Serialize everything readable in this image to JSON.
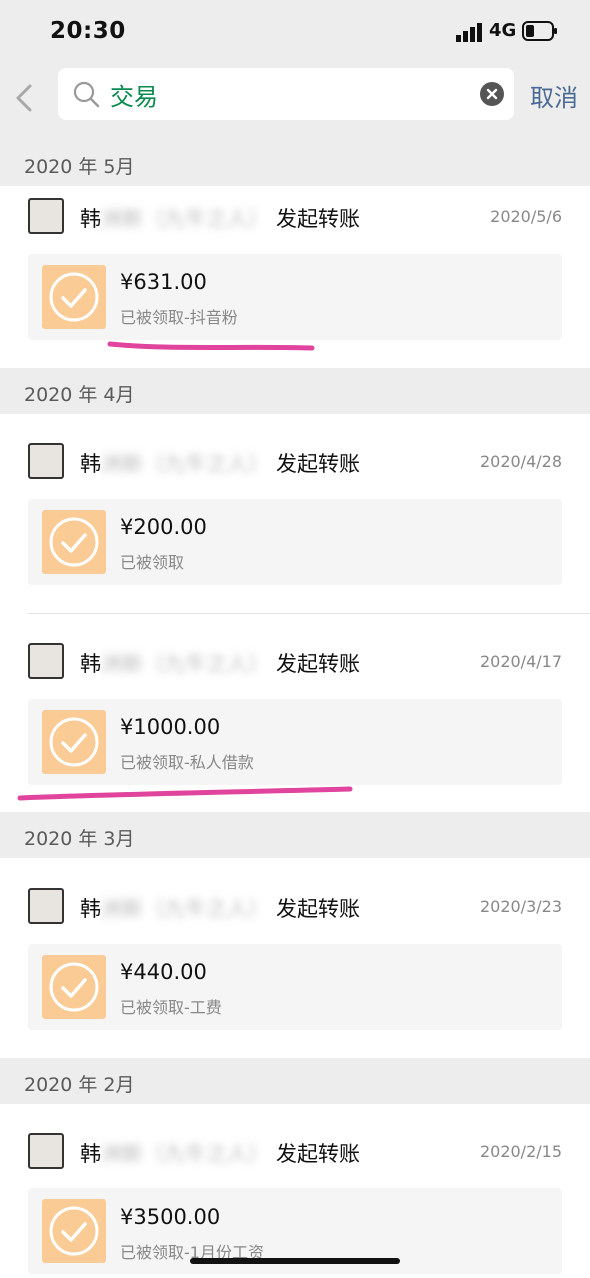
{
  "status_bar": {
    "time": "20:30",
    "network": "4G"
  },
  "search": {
    "query": "交易",
    "cancel_label": "取消"
  },
  "sections": [
    {
      "label": "2020 年 5月"
    },
    {
      "label": "2020 年 4月"
    },
    {
      "label": "2020 年 3月"
    },
    {
      "label": "2020 年 2月"
    }
  ],
  "transactions": [
    {
      "sender_surname": "韩",
      "sender_rest": "洲新（九牛之人）",
      "action": "发起转账",
      "date": "2020/5/6",
      "amount": "¥631.00",
      "status": "已被领取-抖音粉"
    },
    {
      "sender_surname": "韩",
      "sender_rest": "洲新（九牛之人）",
      "action": "发起转账",
      "date": "2020/4/28",
      "amount": "¥200.00",
      "status": "已被领取"
    },
    {
      "sender_surname": "韩",
      "sender_rest": "洲新（九牛之人）",
      "action": "发起转账",
      "date": "2020/4/17",
      "amount": "¥1000.00",
      "status": "已被领取-私人借款"
    },
    {
      "sender_surname": "韩",
      "sender_rest": "洲新（九牛之人）",
      "action": "发起转账",
      "date": "2020/3/23",
      "amount": "¥440.00",
      "status": "已被领取-工费"
    },
    {
      "sender_surname": "韩",
      "sender_rest": "洲新（九牛之人）",
      "action": "发起转账",
      "date": "2020/2/15",
      "amount": "¥3500.00",
      "status": "已被领取-1月份工资"
    }
  ],
  "colors": {
    "card_icon": "#fbcb95",
    "search_text": "#0b8a4f",
    "cancel": "#4a6a95",
    "annotation": "#e0449c"
  }
}
